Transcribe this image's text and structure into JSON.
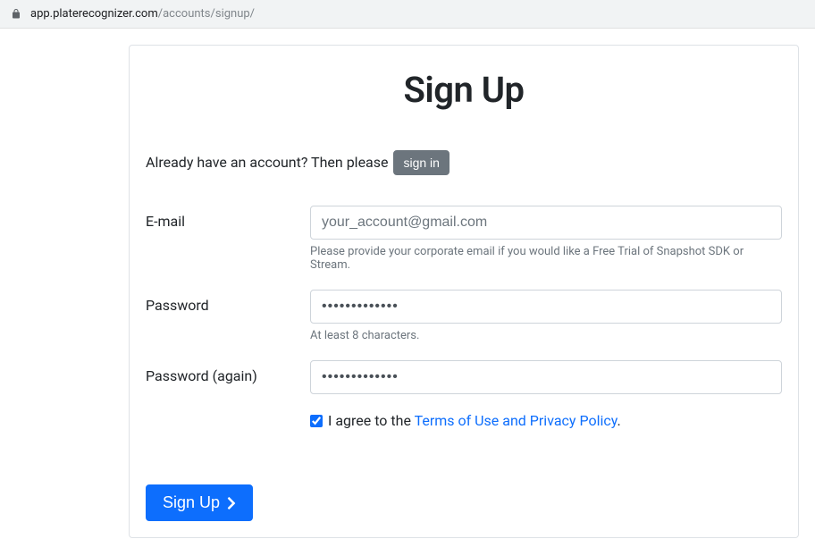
{
  "browser": {
    "url_domain": "app.platerecognizer.com",
    "url_path": "/accounts/signup/"
  },
  "header": {
    "title": "Sign Up"
  },
  "have_account": {
    "text": "Already have an account? Then please ",
    "signin_label": "sign in"
  },
  "form": {
    "email": {
      "label": "E-mail",
      "placeholder": "your_account@gmail.com",
      "help": "Please provide your corporate email if you would like a Free Trial of Snapshot SDK or Stream."
    },
    "password": {
      "label": "Password",
      "value": "•••••••••••••",
      "help": "At least 8 characters."
    },
    "password_again": {
      "label": "Password (again)",
      "value": "•••••••••••••"
    },
    "agree": {
      "prefix_text": " I agree to the ",
      "link_text": "Terms of Use and Privacy Policy",
      "suffix_text": ".",
      "checked": true
    },
    "submit_label": "Sign Up "
  },
  "colors": {
    "primary": "#0d6efd",
    "secondary": "#6c757d",
    "border": "#ced4da"
  }
}
